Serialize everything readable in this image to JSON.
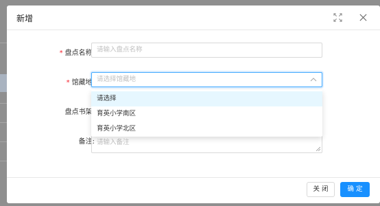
{
  "modal": {
    "title": "新增",
    "icons": {
      "fullscreen": "fullscreen-icon",
      "close": "close-icon"
    }
  },
  "form": {
    "required_mark": "*",
    "name": {
      "label": "盘点名称:",
      "placeholder": "请输入盘点名称",
      "required": true
    },
    "location": {
      "label": "馆藏地:",
      "placeholder": "请选择馆藏地",
      "required": true,
      "icon": "chevron-up-icon"
    },
    "shelf": {
      "label": "盘点书架:"
    },
    "remark": {
      "label": "备注:",
      "placeholder": "请输入备注"
    }
  },
  "dropdown": {
    "options": [
      "请选择",
      "育英小学南区",
      "育英小学北区"
    ],
    "highlighted_index": 0
  },
  "footer": {
    "close_label": "关 闭",
    "ok_label": "确 定"
  },
  "colors": {
    "primary": "#1890ff",
    "required": "#f5222d",
    "overlay": "#8f8f8f"
  }
}
